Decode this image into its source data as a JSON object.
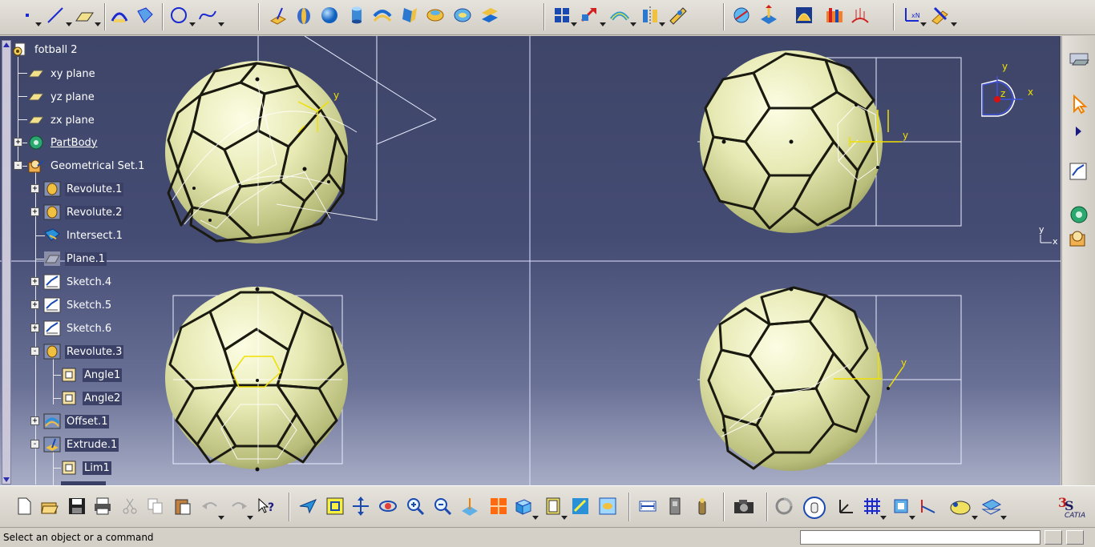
{
  "colors": {
    "viewport_top": "#3e4568",
    "viewport_bottom": "#a8adc6",
    "ball_fill": "#e9ecb9",
    "seam": "#1a1a10",
    "axis_yellow": "#f0e000",
    "selection_orange": "#ff8a1f",
    "compass_blue": "#3f52d8"
  },
  "tree": {
    "root": {
      "label": "fotball 2",
      "icon": "gear-icon"
    },
    "items": [
      {
        "label": "xy plane",
        "icon": "plane-icon",
        "level": 1
      },
      {
        "label": "yz plane",
        "icon": "plane-icon",
        "level": 1
      },
      {
        "label": "zx plane",
        "icon": "plane-icon",
        "level": 1
      },
      {
        "label": "PartBody",
        "icon": "partbody-icon",
        "level": 1,
        "expander": "+"
      },
      {
        "label": "Geometrical Set.1",
        "icon": "geometrical-set-icon",
        "level": 1,
        "expander": "-"
      },
      {
        "label": "Revolute.1",
        "icon": "revolute-icon",
        "level": 2,
        "expander": "+"
      },
      {
        "label": "Revolute.2",
        "icon": "revolute-icon",
        "level": 2,
        "expander": "+"
      },
      {
        "label": "Intersect.1",
        "icon": "intersect-icon",
        "level": 2
      },
      {
        "label": "Plane.1",
        "icon": "plane-feature-icon",
        "level": 2
      },
      {
        "label": "Sketch.4",
        "icon": "sketch-icon",
        "level": 2,
        "expander": "+"
      },
      {
        "label": "Sketch.5",
        "icon": "sketch-icon",
        "level": 2,
        "expander": "+"
      },
      {
        "label": "Sketch.6",
        "icon": "sketch-icon",
        "level": 2,
        "expander": "+"
      },
      {
        "label": "Revolute.3",
        "icon": "revolute-icon",
        "level": 2,
        "expander": "-"
      },
      {
        "label": "Angle1",
        "icon": "parameter-icon",
        "level": 3
      },
      {
        "label": "Angle2",
        "icon": "parameter-icon",
        "level": 3
      },
      {
        "label": "Offset.1",
        "icon": "offset-icon",
        "level": 2,
        "expander": "+"
      },
      {
        "label": "Extrude.1",
        "icon": "extrude-icon",
        "level": 2,
        "expander": "-"
      },
      {
        "label": "Lim1",
        "icon": "parameter-icon",
        "level": 3
      }
    ]
  },
  "views": {
    "axis_x": "x",
    "axis_y": "y",
    "axis_z": "z"
  },
  "status": {
    "message": "Select an object or a command",
    "command_value": ""
  },
  "brand": {
    "logo_text": "CATIA"
  },
  "toolbar_top_icons": [
    "point-icon",
    "line-icon",
    "plane-icon",
    "sweep-icon",
    "fill-icon",
    "circle-icon",
    "spline-icon",
    "extrude-icon",
    "revolve-icon",
    "sphere-icon",
    "cylinder-icon",
    "offset-icon",
    "multi-section-icon",
    "blend-icon",
    "fill-surface-icon",
    "extract-icon",
    "pattern-icon",
    "translate-icon",
    "boundary-icon",
    "split-icon",
    "healing-icon",
    "measure-icon",
    "analysis-icon",
    "curvature-icon",
    "draft-analysis-icon",
    "porcupine-icon",
    "axis-system-icon",
    "tools-icon"
  ],
  "toolbar_bottom_icons": [
    "new-icon",
    "open-icon",
    "save-icon",
    "print-icon",
    "cut-icon",
    "copy-icon",
    "paste-icon",
    "undo-icon",
    "redo-icon",
    "whats-this-icon",
    "fly-mode-icon",
    "fit-all-icon",
    "pan-icon",
    "rotate-icon",
    "zoom-in-icon",
    "zoom-out-icon",
    "normal-view-icon",
    "multi-view-icon",
    "iso-view-icon",
    "render-style-icon",
    "hide-show-icon",
    "swap-space-icon",
    "measure-between-icon",
    "catalog-icon",
    "knowledge-icon",
    "photo-icon",
    "update-icon",
    "hand-icon",
    "axis-icon",
    "grid-icon",
    "snap-icon",
    "constraint-icon",
    "sketch-tools-icon",
    "layer-icon"
  ]
}
